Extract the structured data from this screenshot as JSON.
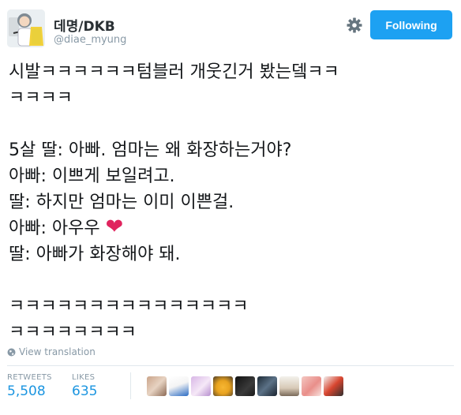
{
  "user": {
    "display_name": "데명/DKB",
    "handle": "@diae_myung",
    "follow_label": "Following"
  },
  "tweet": {
    "lines": [
      "시발ㅋㅋㅋㅋㅋㅋ텀블러 개웃긴거 봤는뎈ㅋㅋ",
      "ㅋㅋㅋㅋ",
      "",
      "5살 딸: 아빠. 엄마는 왜 화장하는거야?",
      "아빠: 이쁘게 보일려고.",
      "딸: 하지만 엄마는 이미 이쁜걸.",
      "아빠: 아우우",
      "딸: 아빠가 화장해야 돼.",
      "",
      "ㅋㅋㅋㅋㅋㅋㅋㅋㅋㅋㅋㅋㅋㅋㅋ",
      "ㅋㅋㅋㅋㅋㅋㅋㅋ"
    ],
    "heart_glyph": "❤"
  },
  "view_translation": "View translation",
  "stats": {
    "retweets_label": "RETWEETS",
    "retweets_value": "5,508",
    "likes_label": "LIKES",
    "likes_value": "635"
  },
  "icons": {
    "settings": "gear-icon",
    "translate": "globe-icon",
    "emoji": "red-heart"
  },
  "colors": {
    "accent": "#1da1f2",
    "stat_value": "#1b95e0",
    "muted": "#8899a6",
    "heart": "#e0245e"
  }
}
